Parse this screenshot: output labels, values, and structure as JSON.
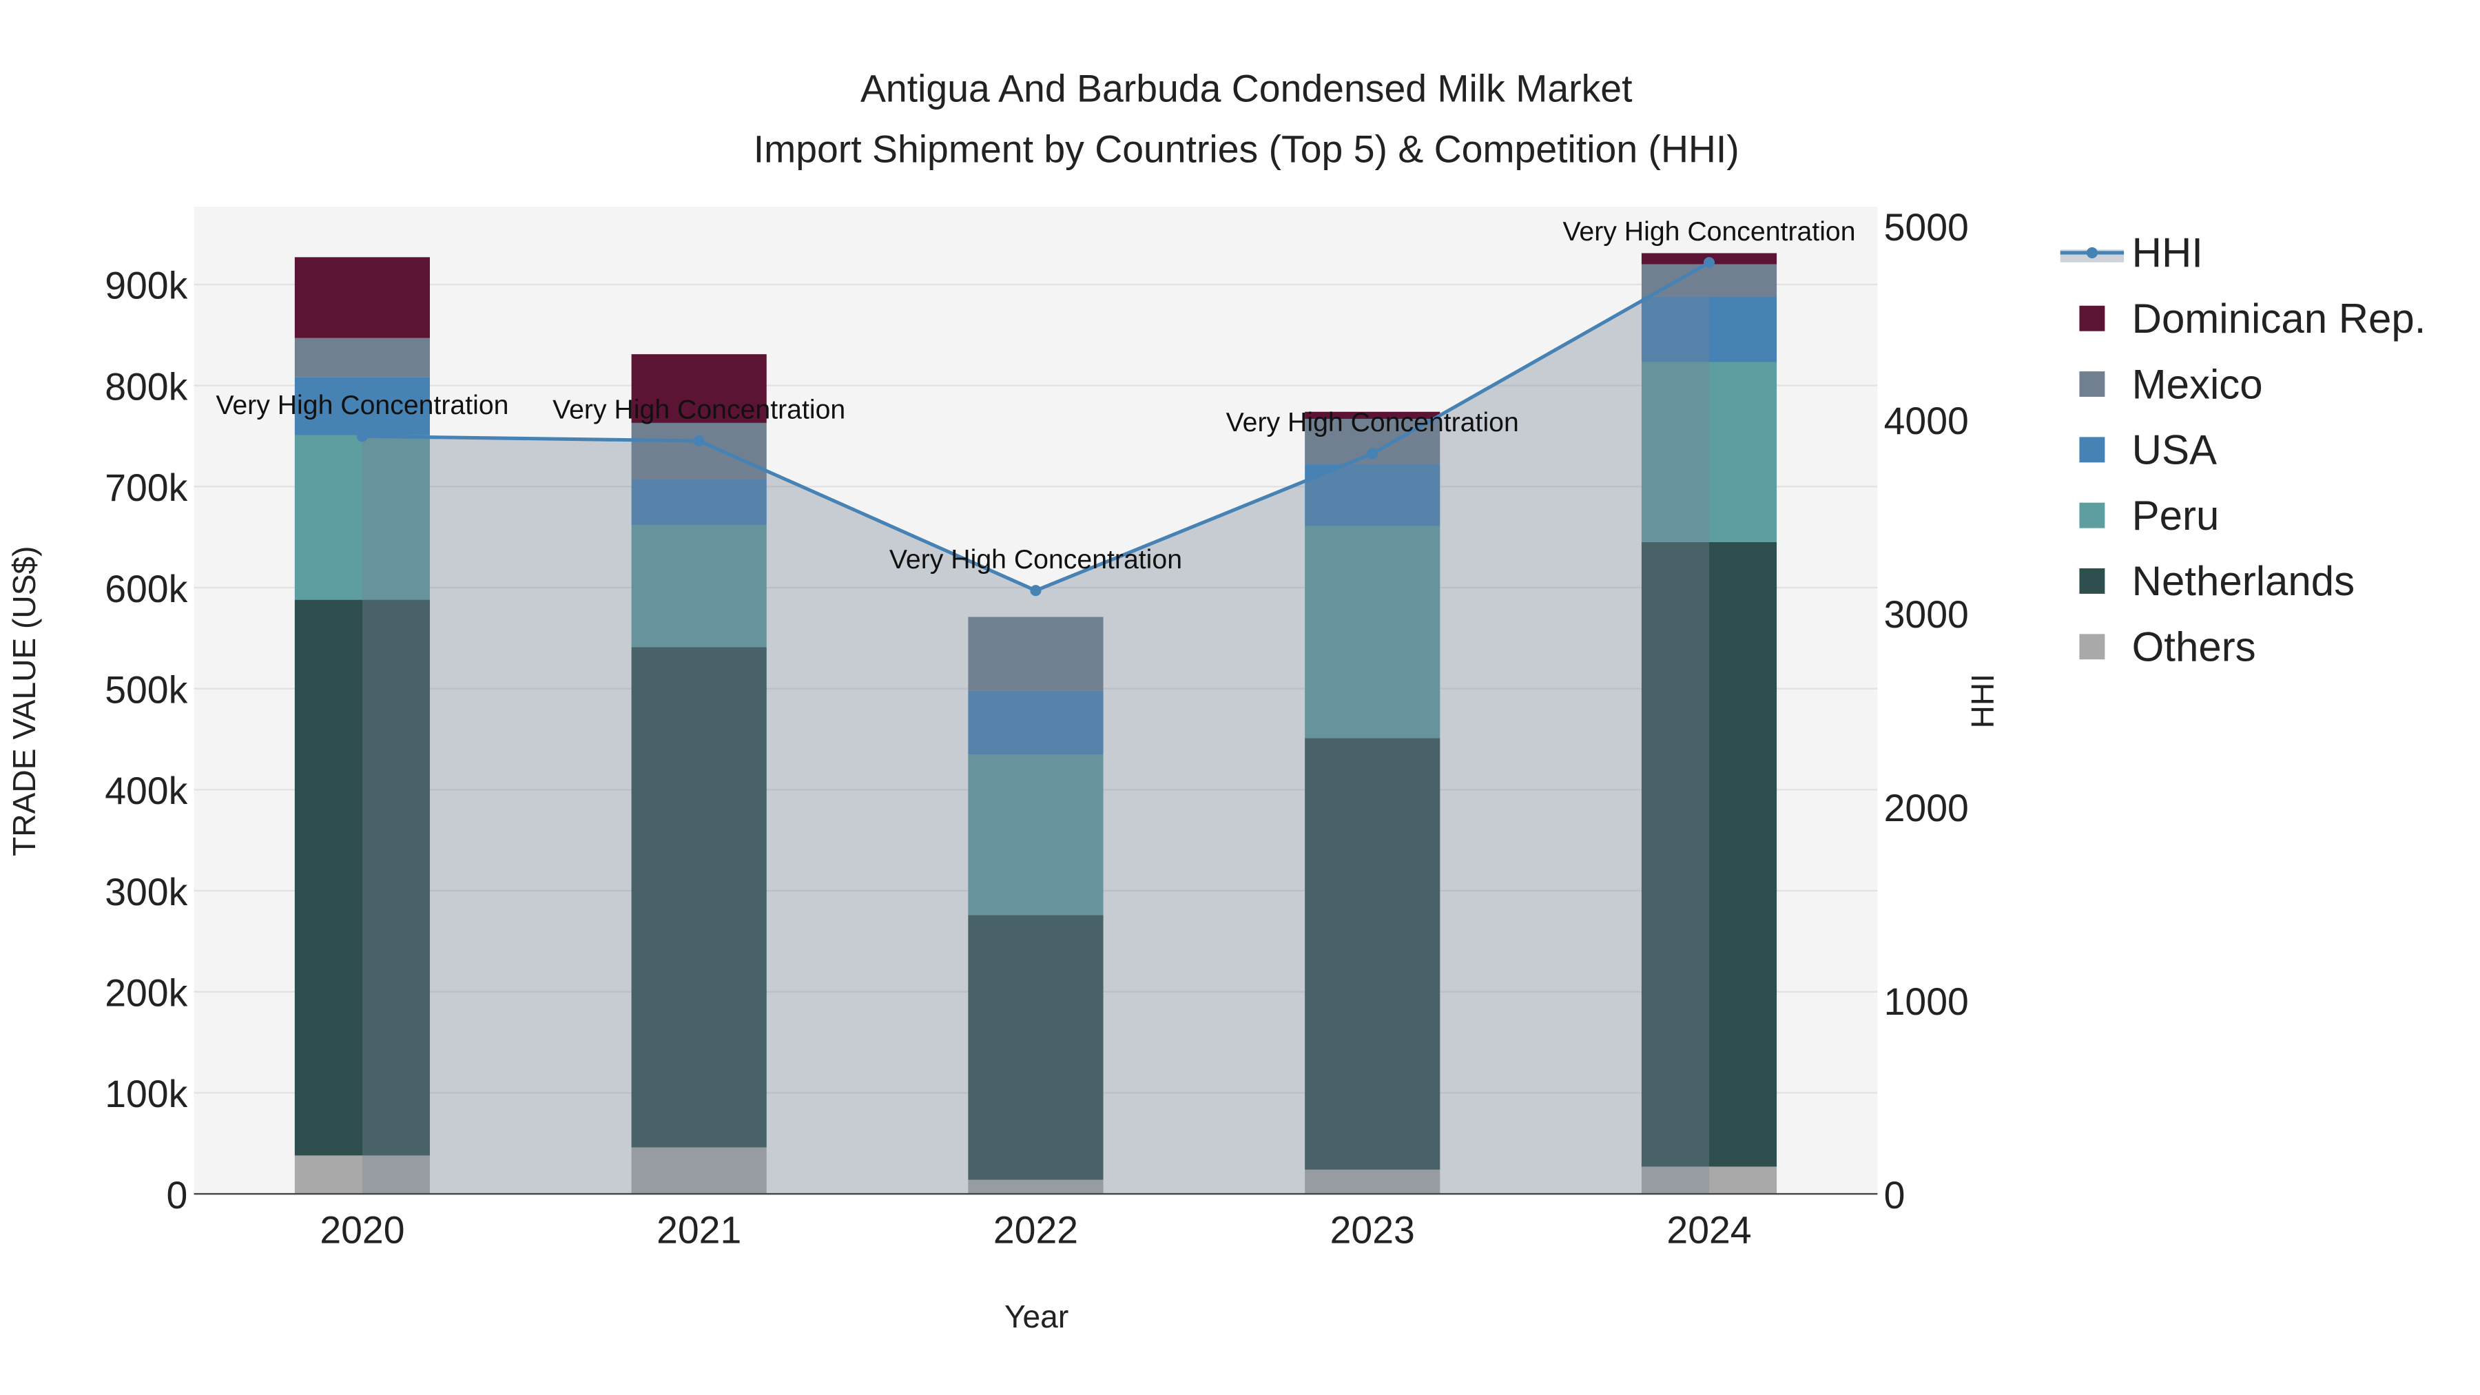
{
  "chart_data": {
    "type": "bar",
    "title_line1": "Antigua And Barbuda Condensed Milk Market",
    "title_line2": "Import Shipment by Countries (Top 5) & Competition (HHI)",
    "xlabel": "Year",
    "ylabel": "TRADE VALUE (US$)",
    "y2label": "HHI",
    "categories": [
      "2020",
      "2021",
      "2022",
      "2023",
      "2024"
    ],
    "ylim": [
      0,
      977000
    ],
    "y2lim": [
      0,
      5100
    ],
    "yticks": [
      0,
      100000,
      200000,
      300000,
      400000,
      500000,
      600000,
      700000,
      800000,
      900000
    ],
    "ytick_labels": [
      "0",
      "100k",
      "200k",
      "300k",
      "400k",
      "500k",
      "600k",
      "700k",
      "800k",
      "900k"
    ],
    "y2ticks": [
      0,
      1000,
      2000,
      3000,
      4000,
      5000
    ],
    "y2tick_labels": [
      "0",
      "1000",
      "2000",
      "3000",
      "4000",
      "5000"
    ],
    "stacked": true,
    "series": [
      {
        "name": "Others",
        "color": "#a9a9a9",
        "values": [
          38000,
          46000,
          14000,
          24000,
          27000
        ]
      },
      {
        "name": "Netherlands",
        "color": "#2f4f4f",
        "values": [
          550000,
          495000,
          262000,
          427000,
          618000
        ]
      },
      {
        "name": "Peru",
        "color": "#5f9ea0",
        "values": [
          163000,
          121000,
          159000,
          210000,
          178000
        ]
      },
      {
        "name": "USA",
        "color": "#4682b4",
        "values": [
          57000,
          45000,
          63000,
          61000,
          65000
        ]
      },
      {
        "name": "Mexico",
        "color": "#708090",
        "values": [
          39000,
          56000,
          73000,
          45000,
          32000
        ]
      },
      {
        "name": "Dominican Rep.",
        "color": "#5c1434",
        "values": [
          80000,
          68000,
          0,
          7000,
          11000
        ]
      }
    ],
    "hhi": {
      "name": "HHI",
      "color": "#4682b4",
      "values": [
        3914,
        3890,
        3117,
        3824,
        4811
      ],
      "annotations": [
        "Very High Concentration",
        "Very High Concentration",
        "Very High Concentration",
        "Very High Concentration",
        "Very High Concentration"
      ]
    },
    "legend": [
      "HHI",
      "Dominican Rep.",
      "Mexico",
      "USA",
      "Peru",
      "Netherlands",
      "Others"
    ],
    "legend_position": "right",
    "grid": true
  }
}
